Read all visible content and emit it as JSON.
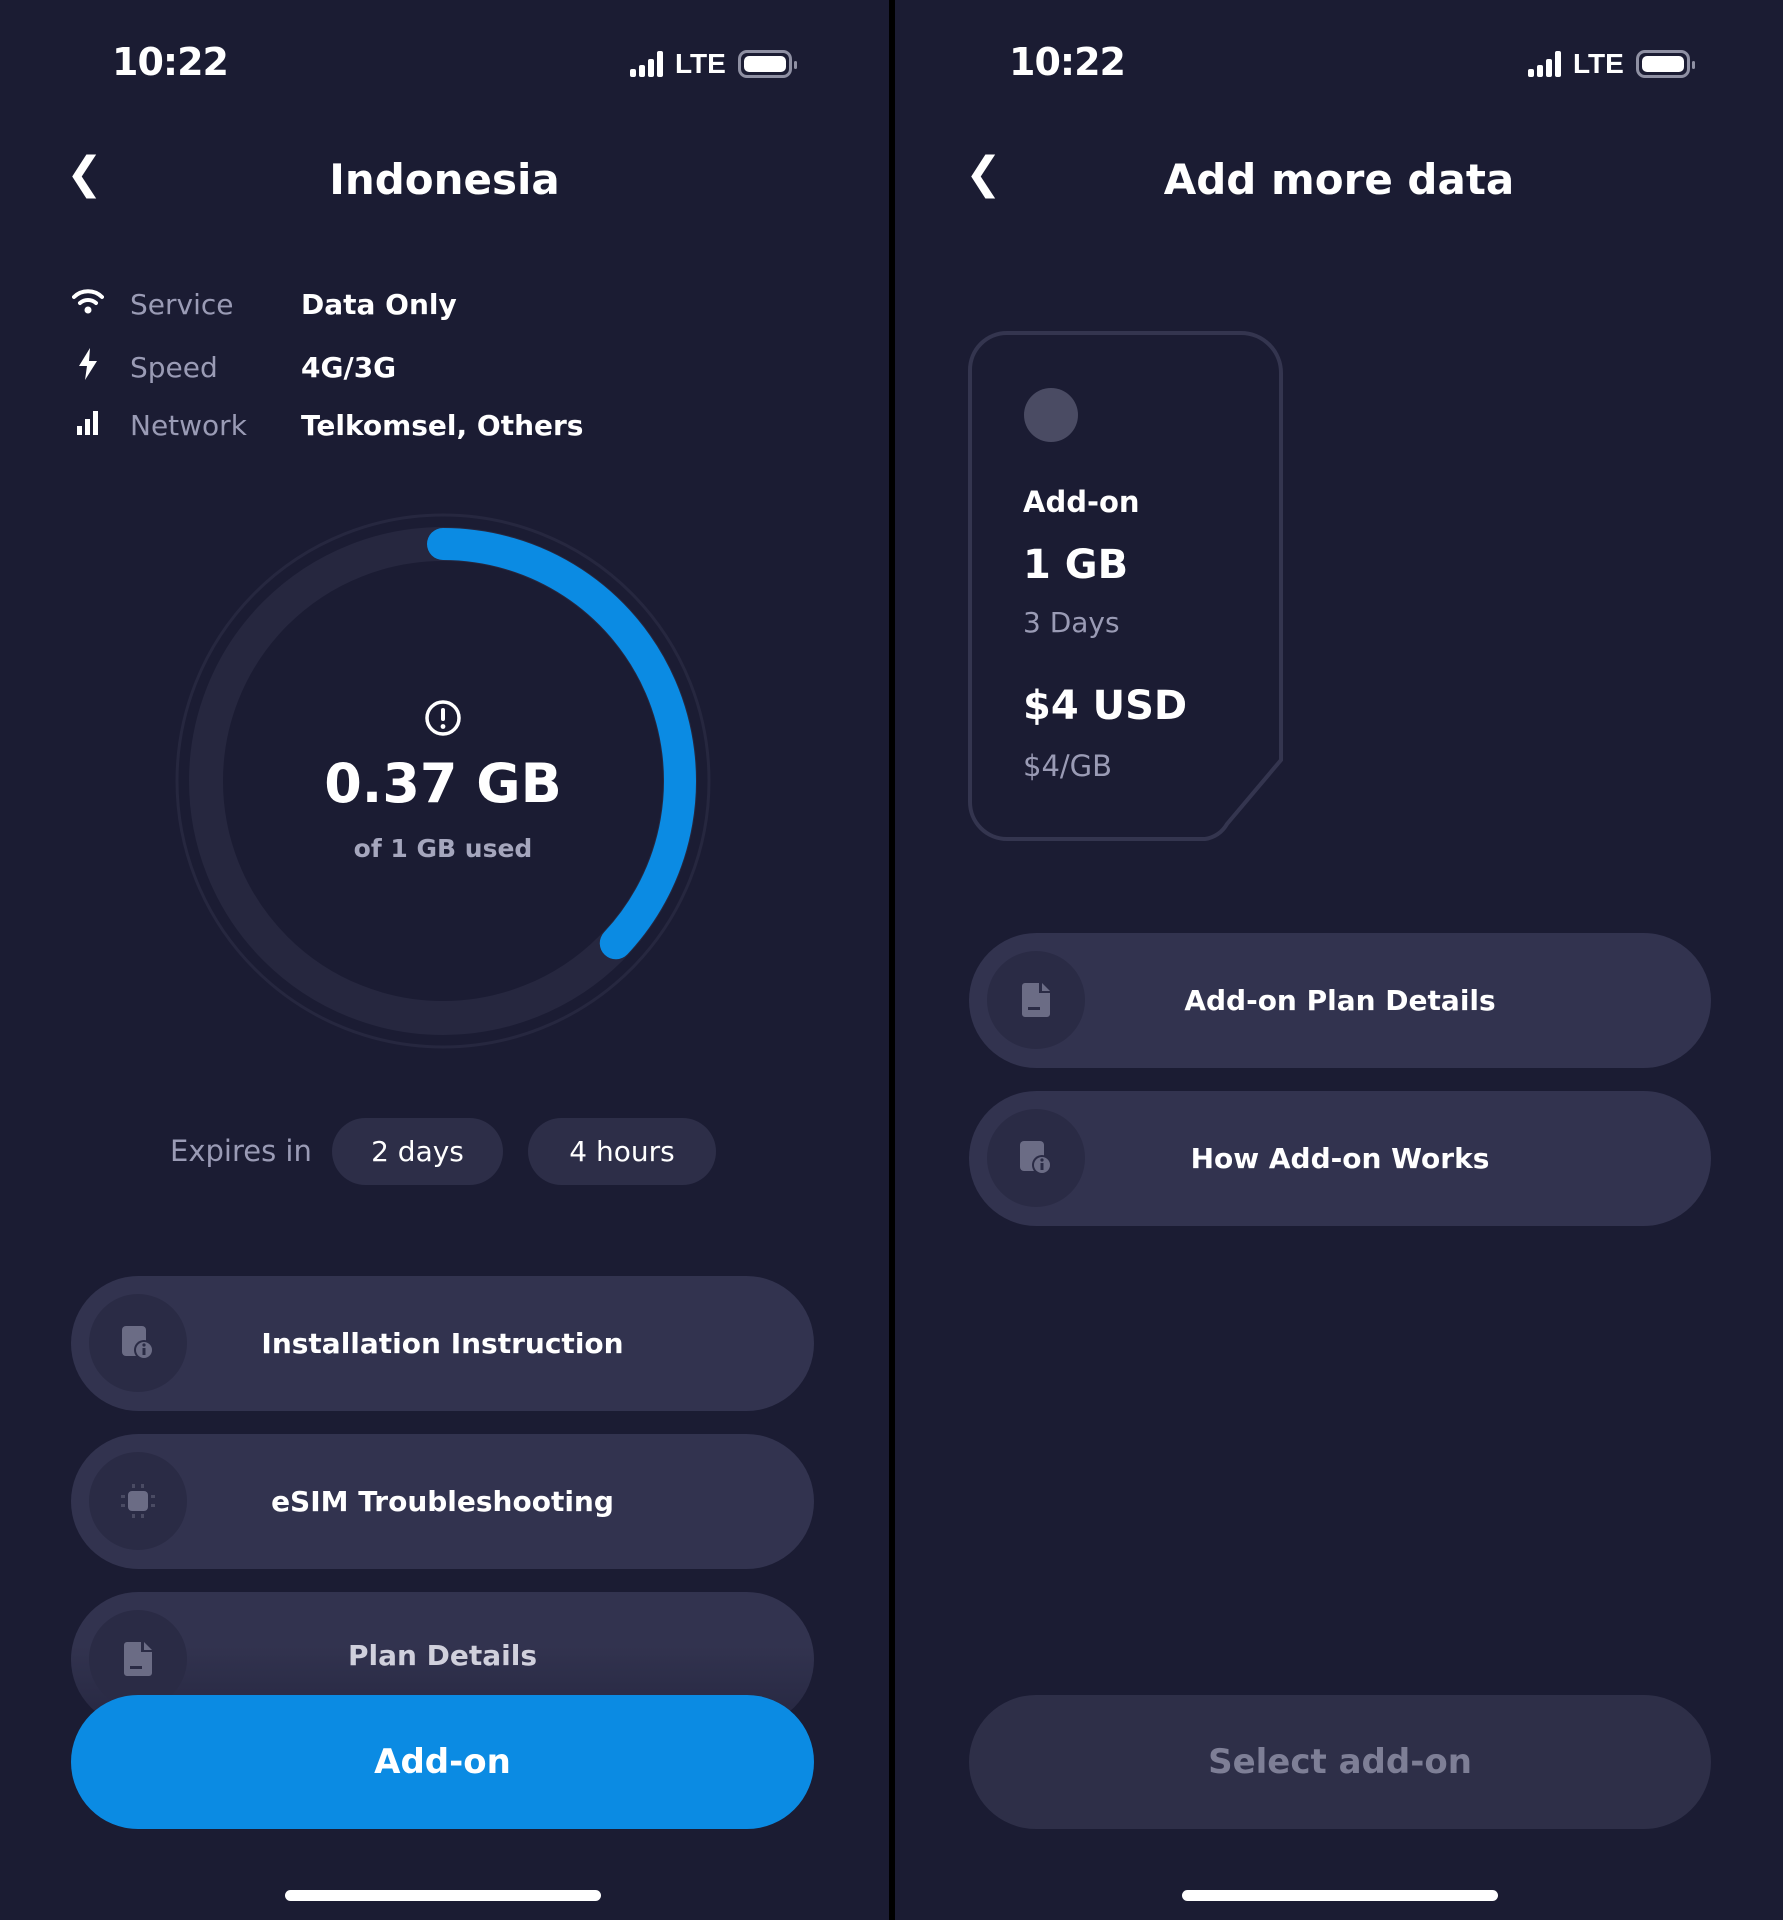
{
  "status_bar": {
    "time": "10:22",
    "network": "LTE"
  },
  "usage_screen": {
    "title": "Indonesia",
    "info": [
      {
        "icon": "wifi-icon",
        "label": "Service",
        "value": "Data Only"
      },
      {
        "icon": "bolt-icon",
        "label": "Speed",
        "value": "4G/3G"
      },
      {
        "icon": "signal-bars-icon",
        "label": "Network",
        "value": "Telkomsel, Others"
      }
    ],
    "usage": {
      "used": "0.37 GB",
      "caption": "of 1 GB used",
      "fraction_used": 0.37,
      "accent": "#0b8be3"
    },
    "expires": {
      "label": "Expires in",
      "days": "2 days",
      "hours": "4 hours"
    },
    "buttons": [
      {
        "icon": "file-info-icon",
        "label": "Installation Instruction"
      },
      {
        "icon": "chip-icon",
        "label": "eSIM Troubleshooting"
      },
      {
        "icon": "document-icon",
        "label": "Plan Details"
      }
    ],
    "primary": "Add-on"
  },
  "addon_screen": {
    "title": "Add more data",
    "card": {
      "name": "Add-on",
      "data": "1 GB",
      "duration": "3 Days",
      "price": "$4 USD",
      "unit_price": "$4/GB"
    },
    "buttons": [
      {
        "icon": "document-icon",
        "label": "Add-on Plan Details"
      },
      {
        "icon": "file-info-icon",
        "label": "How Add-on Works"
      }
    ],
    "primary": "Select add-on"
  }
}
